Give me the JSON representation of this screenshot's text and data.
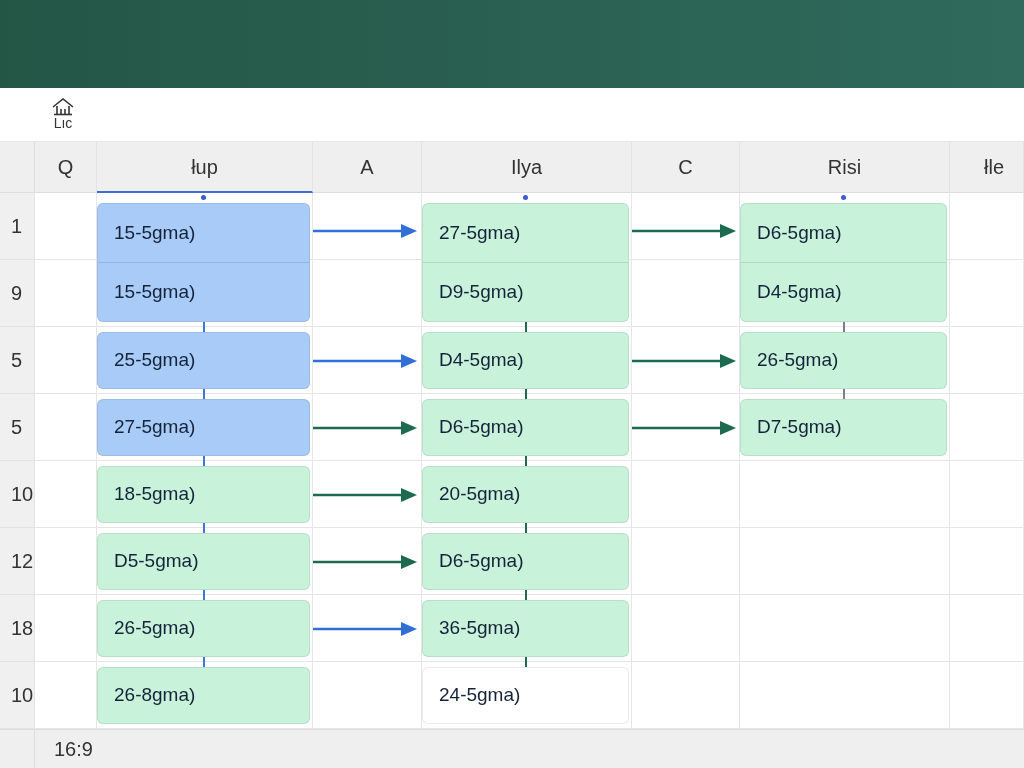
{
  "toolbar": {
    "logo_text": "Lıc"
  },
  "sheet": {
    "columns": [
      {
        "label": "Q",
        "selected": false
      },
      {
        "label": "łup",
        "selected": true
      },
      {
        "label": "A",
        "selected": false
      },
      {
        "label": "Ilya",
        "selected": false
      },
      {
        "label": "C",
        "selected": false
      },
      {
        "label": "Risi",
        "selected": false
      },
      {
        "label": "łle",
        "selected": false
      }
    ],
    "rows": [
      "1",
      "9",
      "5",
      "5",
      "10",
      "12",
      "18",
      "10"
    ],
    "lanes": [
      {
        "color": "#3a78d8",
        "cards": [
          {
            "lines": [
              "15-5gma)",
              "15-5gma)"
            ],
            "color": "#a9cbf7",
            "arrow": {
              "color": "#2f6fd6"
            }
          },
          {
            "lines": [
              "25-5gma)"
            ],
            "color": "#a9cbf7",
            "arrow": {
              "color": "#2f6fd6"
            }
          },
          {
            "lines": [
              "27-5gma)"
            ],
            "color": "#a9cbf7",
            "arrow": {
              "color": "#1d6a50"
            }
          },
          {
            "lines": [
              "18-5gma)"
            ],
            "color": "#c8f2d9",
            "arrow": {
              "color": "#1d6a50"
            }
          },
          {
            "lines": [
              "D5-5gma)"
            ],
            "color": "#c8f2d9",
            "arrow": {
              "color": "#1d6a50"
            }
          },
          {
            "lines": [
              "26-5gma)"
            ],
            "color": "#c8f2d9",
            "arrow": {
              "color": "#2f6fd6"
            }
          },
          {
            "lines": [
              "26-8gma)"
            ],
            "color": "#c8f2d9"
          }
        ]
      },
      {
        "color": "#1d6a50",
        "cards": [
          {
            "lines": [
              "27-5gma)",
              "D9-5gma)"
            ],
            "color": "#c8f2d9",
            "arrow": {
              "color": "#1d6a50"
            }
          },
          {
            "lines": [
              "D4-5gma)"
            ],
            "color": "#c8f2d9",
            "arrow": {
              "color": "#1d6a50"
            }
          },
          {
            "lines": [
              "D6-5gma)"
            ],
            "color": "#c8f2d9",
            "arrow": {
              "color": "#1d6a50"
            }
          },
          {
            "lines": [
              "20-5gma)"
            ],
            "color": "#c8f2d9"
          },
          {
            "lines": [
              "D6-5gma)"
            ],
            "color": "#c8f2d9"
          },
          {
            "lines": [
              "36-5gma)"
            ],
            "color": "#c8f2d9"
          },
          {
            "lines": [
              "24-5gma)"
            ],
            "color": "#ffffff"
          }
        ]
      },
      {
        "color": "#7a7f8c",
        "cards": [
          {
            "lines": [
              "D6-5gma)",
              "D4-5gma)"
            ],
            "color": "#c8f2d9"
          },
          {
            "lines": [
              "26-5gma)"
            ],
            "color": "#c8f2d9"
          },
          {
            "lines": [
              "D7-5gma)"
            ],
            "color": "#c8f2d9"
          }
        ]
      }
    ]
  },
  "status_bar": {
    "text": "16:9"
  }
}
